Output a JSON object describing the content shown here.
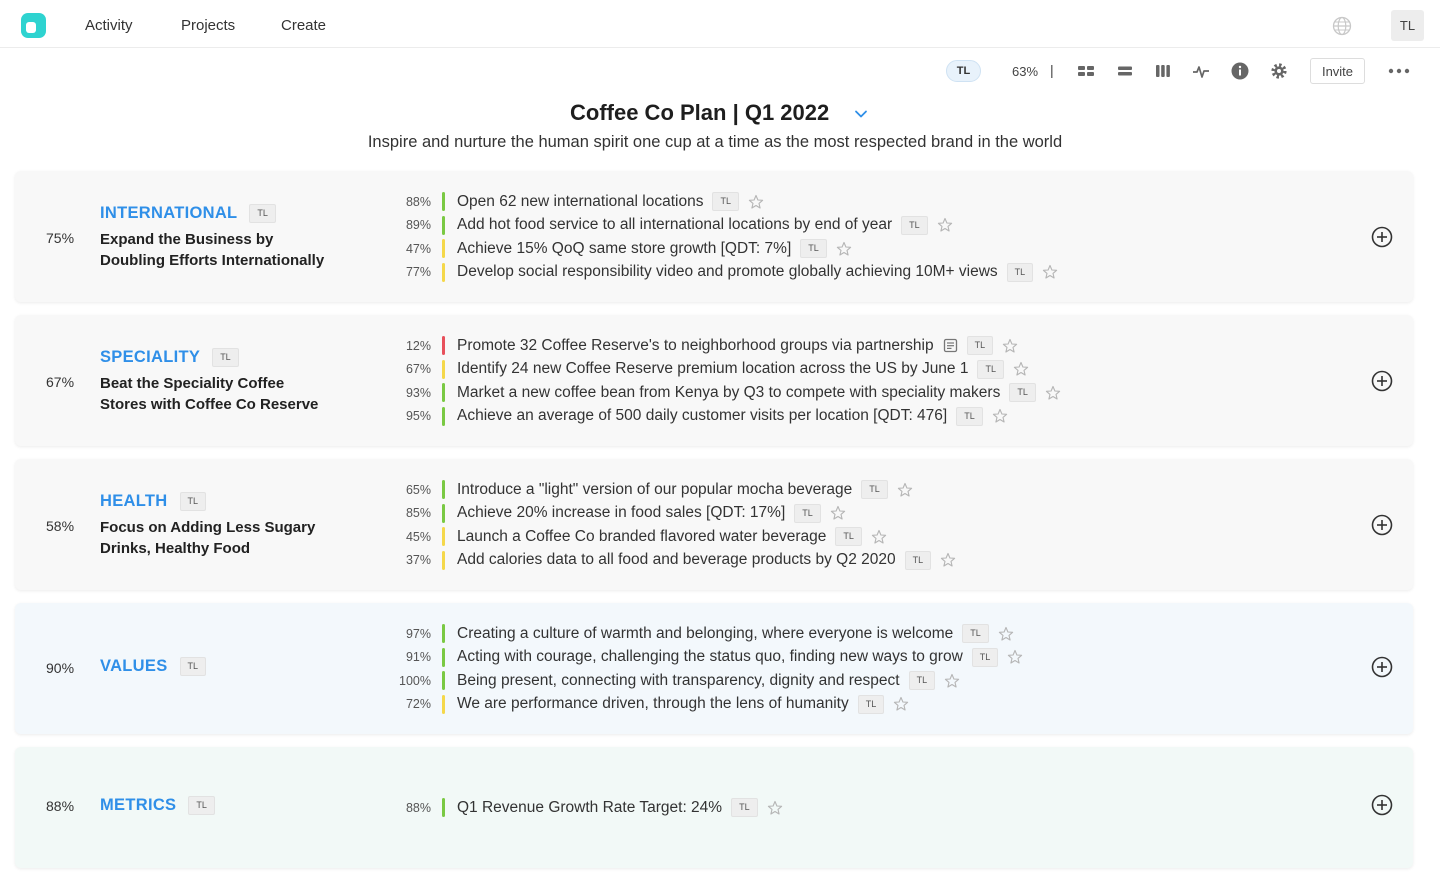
{
  "nav": {
    "items": [
      "Activity",
      "Projects",
      "Create"
    ],
    "avatar": "TL"
  },
  "toolbar": {
    "avatar": "TL",
    "progress": "63%",
    "separator": "|",
    "invite_label": "Invite"
  },
  "plan": {
    "title": "Coffee Co Plan | Q1 2022",
    "mission": "Inspire and nurture the human spirit one cup at a time as the most respected brand in the world"
  },
  "colors": {
    "accent": "#2f8fe8",
    "green": "#7ac943",
    "yellow": "#f5d84a",
    "red": "#e8505b"
  },
  "objectives": [
    {
      "pct": "75%",
      "label": "INTERNATIONAL",
      "owner": "TL",
      "desc_lines": [
        "Expand the Business by",
        "Doubling Efforts Internationally"
      ],
      "bg": "#f8f8f8",
      "key_results": [
        {
          "pct": "88%",
          "text": "Open 62 new international locations",
          "owner": "TL",
          "status": "green"
        },
        {
          "pct": "89%",
          "text": "Add hot food service to all international locations by end of year",
          "owner": "TL",
          "status": "green"
        },
        {
          "pct": "47%",
          "text": "Achieve 15% QoQ same store growth [QDT: 7%]",
          "owner": "TL",
          "status": "yellow"
        },
        {
          "pct": "77%",
          "text": "Develop social responsibility video and promote globally achieving 10M+ views",
          "owner": "TL",
          "status": "yellow"
        }
      ]
    },
    {
      "pct": "67%",
      "label": "SPECIALITY",
      "owner": "TL",
      "desc_lines": [
        "Beat the Speciality Coffee",
        "Stores with Coffee Co Reserve"
      ],
      "bg": "#f8f8f8",
      "key_results": [
        {
          "pct": "12%",
          "text": "Promote 32 Coffee Reserve's to neighborhood groups via partnership",
          "owner": "TL",
          "status": "red",
          "has_note": true
        },
        {
          "pct": "67%",
          "text": "Identify 24 new Coffee Reserve premium location across the US by June 1",
          "owner": "TL",
          "status": "yellow"
        },
        {
          "pct": "93%",
          "text": "Market a new coffee bean from Kenya by Q3 to compete with speciality makers",
          "owner": "TL",
          "status": "green"
        },
        {
          "pct": "95%",
          "text": "Achieve an average of 500 daily customer visits per location [QDT: 476]",
          "owner": "TL",
          "status": "green"
        }
      ]
    },
    {
      "pct": "58%",
      "label": "HEALTH",
      "owner": "TL",
      "desc_lines": [
        "Focus on Adding Less Sugary",
        "Drinks, Healthy Food"
      ],
      "bg": "#f8f8f8",
      "key_results": [
        {
          "pct": "65%",
          "text": "Introduce a \"light\" version of our popular mocha beverage",
          "owner": "TL",
          "status": "green"
        },
        {
          "pct": "85%",
          "text": "Achieve 20% increase in food sales [QDT: 17%]",
          "owner": "TL",
          "status": "green"
        },
        {
          "pct": "45%",
          "text": "Launch a Coffee Co branded flavored water beverage",
          "owner": "TL",
          "status": "yellow"
        },
        {
          "pct": "37%",
          "text": "Add calories data to all food and beverage products by Q2 2020",
          "owner": "TL",
          "status": "yellow"
        }
      ]
    },
    {
      "pct": "90%",
      "label": "VALUES",
      "owner": "TL",
      "desc_lines": [],
      "bg": "#f3f8fc",
      "key_results": [
        {
          "pct": "97%",
          "text": "Creating a culture of warmth and belonging, where everyone is welcome",
          "owner": "TL",
          "status": "green"
        },
        {
          "pct": "91%",
          "text": "Acting with courage, challenging the status quo, finding new ways to grow",
          "owner": "TL",
          "status": "green"
        },
        {
          "pct": "100%",
          "text": "Being present, connecting with transparency, dignity and respect",
          "owner": "TL",
          "status": "green"
        },
        {
          "pct": "72%",
          "text": "We are performance driven, through the lens of humanity",
          "owner": "TL",
          "status": "yellow"
        }
      ]
    },
    {
      "pct": "88%",
      "label": "METRICS",
      "owner": "TL",
      "desc_lines": [],
      "bg": "#f2f9f7",
      "key_results": [
        {
          "pct": "88%",
          "text": "Q1 Revenue Growth Rate Target: 24%",
          "owner": "TL",
          "status": "green"
        }
      ]
    }
  ]
}
